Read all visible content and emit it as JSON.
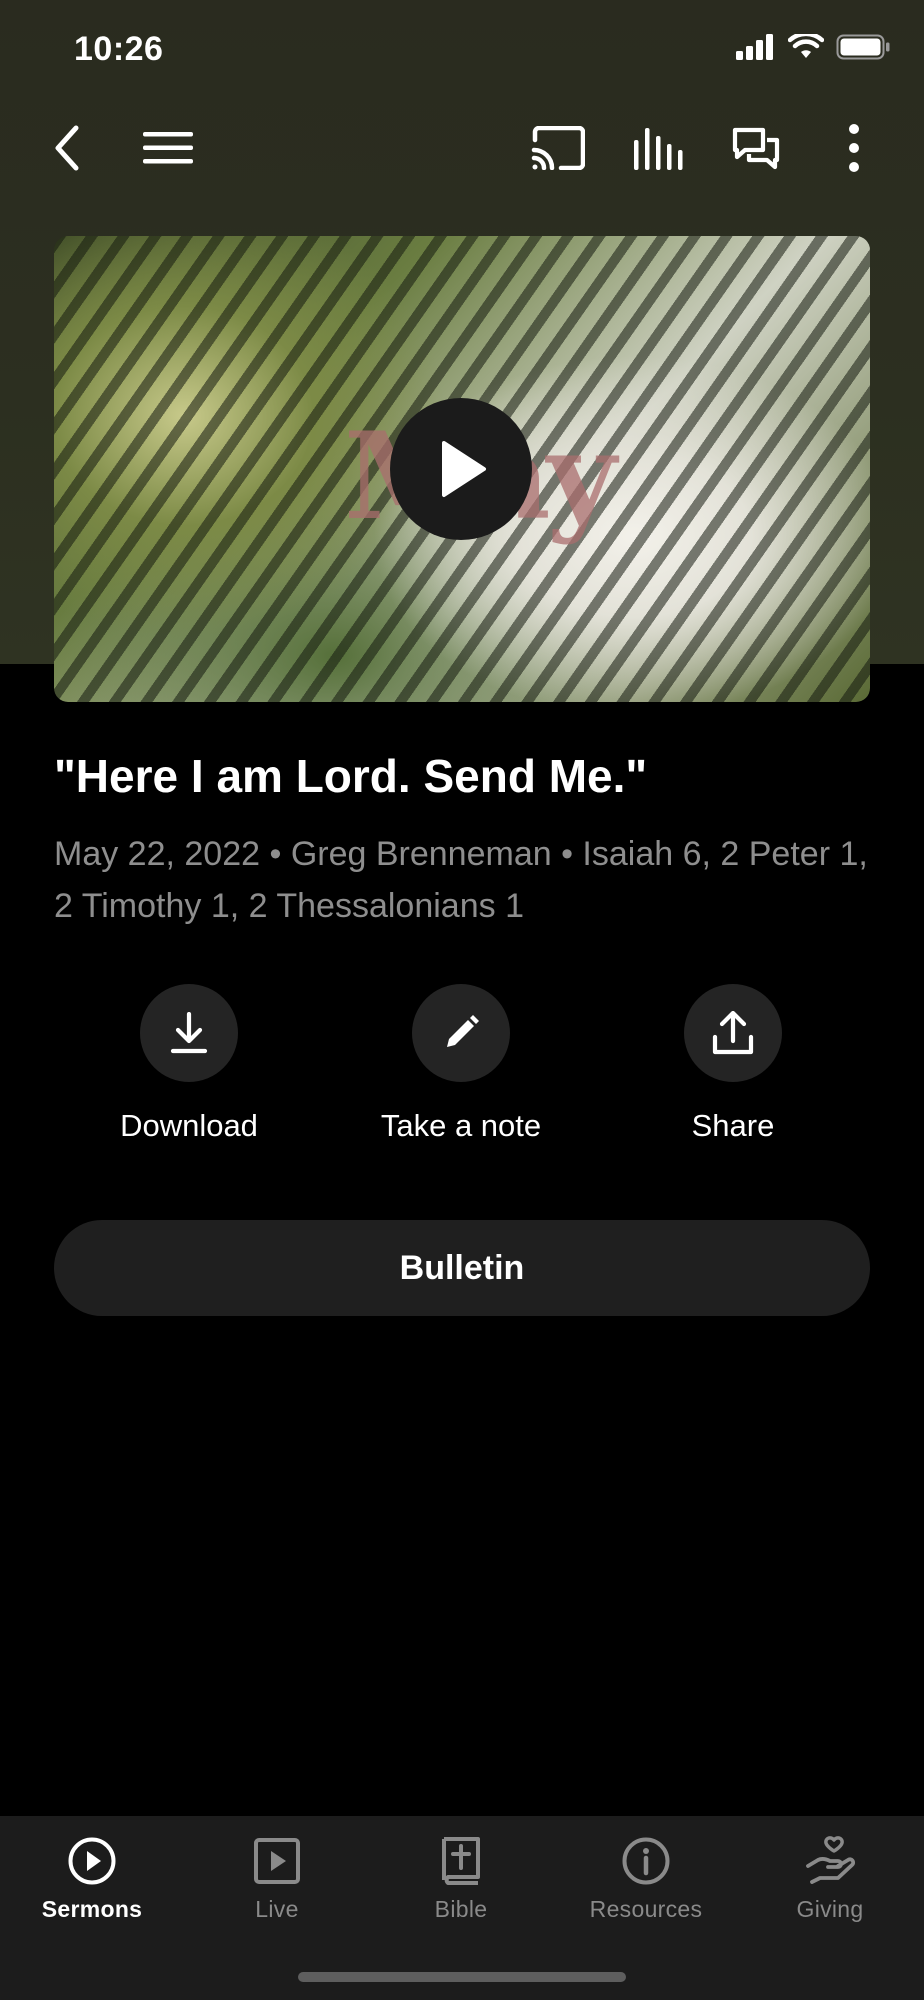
{
  "status": {
    "time": "10:26"
  },
  "hero": {
    "overlay_word": "May"
  },
  "sermon": {
    "title": "\"Here I am Lord. Send Me.\"",
    "meta": "May 22, 2022 • Greg Brenneman • Isaiah 6, 2 Peter 1, 2 Timothy 1, 2 Thessalonians 1"
  },
  "actions": [
    {
      "label": "Download",
      "icon": "download-icon"
    },
    {
      "label": "Take a note",
      "icon": "pencil-icon"
    },
    {
      "label": "Share",
      "icon": "share-icon"
    }
  ],
  "bulletin_label": "Bulletin",
  "tabs": [
    {
      "label": "Sermons",
      "icon": "play-circle-icon",
      "active": true
    },
    {
      "label": "Live",
      "icon": "play-square-icon",
      "active": false
    },
    {
      "label": "Bible",
      "icon": "bible-icon",
      "active": false
    },
    {
      "label": "Resources",
      "icon": "info-icon",
      "active": false
    },
    {
      "label": "Giving",
      "icon": "giving-hand-icon",
      "active": false
    }
  ],
  "colors": {
    "background": "#000000",
    "header_tint": "#2c2f20",
    "muted_text": "#8e8e8e",
    "button_surface": "#242424",
    "tabbar": "#1c1c1c"
  }
}
